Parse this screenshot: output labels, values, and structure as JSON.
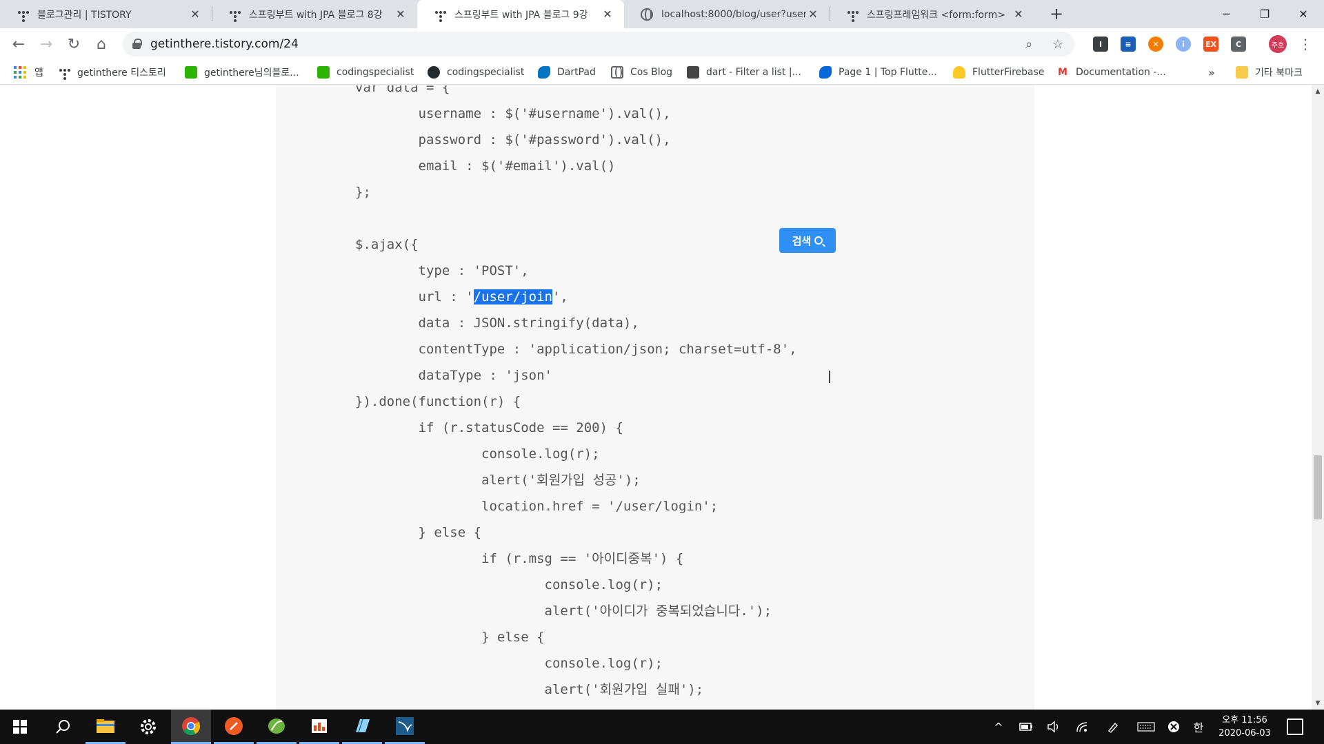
{
  "tabs": [
    {
      "title": "블로그관리 | TISTORY",
      "icon": "tistory-icon",
      "active": false
    },
    {
      "title": "스프링부트 with JPA 블로그 8강",
      "icon": "tistory-icon",
      "active": false
    },
    {
      "title": "스프링부트 with JPA 블로그 9강",
      "icon": "tistory-icon",
      "active": true
    },
    {
      "title": "localhost:8000/blog/user?usern",
      "icon": "globe-icon",
      "active": false
    },
    {
      "title": "스프링프레임워크 <form:form>",
      "icon": "tistory-icon",
      "active": false
    }
  ],
  "address": {
    "url": "getinthere.tistory.com/24"
  },
  "profile": {
    "initials": "주호"
  },
  "bookmarks": [
    {
      "label": "앱",
      "icon": "apps-icon"
    },
    {
      "label": "getinthere 티스토리",
      "icon": "tistory-icon"
    },
    {
      "label": "getinthere님의블로...",
      "icon": "blog-icon"
    },
    {
      "label": "codingspecialist",
      "icon": "blog-icon"
    },
    {
      "label": "codingspecialist",
      "icon": "github-icon"
    },
    {
      "label": "DartPad",
      "icon": "dart-icon"
    },
    {
      "label": "Cos Blog",
      "icon": "globe-icon"
    },
    {
      "label": "dart - Filter a list |...",
      "icon": "stackoverflow-icon"
    },
    {
      "label": "Page 1 | Top Flutte...",
      "icon": "flutter-icon"
    },
    {
      "label": "FlutterFirebase",
      "icon": "firebase-icon"
    },
    {
      "label": "Documentation -...",
      "icon": "docs-icon"
    },
    {
      "label": "기타 북마크",
      "icon": "folder-icon"
    }
  ],
  "code_lines": [
    "var data = {",
    "        username : $('#username').val(),",
    "        password : $('#password').val(),",
    "        email : $('#email').val()",
    "};",
    "",
    "$.ajax({",
    "        type : 'POST',",
    "        url : '/user/join',",
    "        data : JSON.stringify(data),",
    "        contentType : 'application/json; charset=utf-8',",
    "        dataType : 'json'",
    "}).done(function(r) {",
    "        if (r.statusCode == 200) {",
    "                console.log(r);",
    "                alert('회원가입 성공');",
    "                location.href = '/user/login';",
    "        } else {",
    "                if (r.msg == '아이디중복') {",
    "                        console.log(r);",
    "                        alert('아이디가 중복되었습니다.');",
    "                } else {",
    "                        console.log(r);",
    "                        alert('회원가입 실패');",
    "                }"
  ],
  "selection": {
    "text": "/user/join",
    "line": 8
  },
  "search_button": {
    "label": "검색"
  },
  "scroll": {
    "position_pct": 58
  },
  "taskbar": {
    "apps": [
      "start-icon",
      "search-icon",
      "file-explorer-icon",
      "settings-icon",
      "chrome-icon",
      "postman-icon",
      "spring-tools-icon",
      "office-icon",
      "notepad-icon",
      "mysql-workbench-icon"
    ],
    "tray": {
      "ime": "한"
    },
    "clock": {
      "time": "오후 11:56",
      "date": "2020-06-03"
    }
  },
  "colors": {
    "accent": "#1a73e8",
    "code_bg": "#f7f7f7",
    "search_button": "#2f8ff5",
    "taskbar": "#101010"
  }
}
